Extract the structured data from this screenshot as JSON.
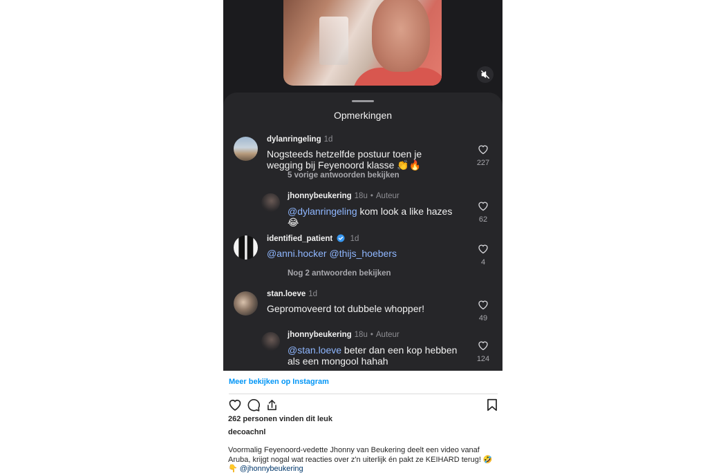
{
  "sheet": {
    "title": "Opmerkingen"
  },
  "comments": [
    {
      "username": "dylanringeling",
      "time": "1d",
      "text": "Nogsteeds hetzelfde postuur toen je wegging bij Feyenoord klasse 👏🔥",
      "likes": "227",
      "more_replies": "5 vorige antwoorden bekijken"
    },
    {
      "username": "jhonnybeukering",
      "time": "18u",
      "badge": "Auteur",
      "mention": "@dylanringeling",
      "text": " kom look a like hazes",
      "text2": "😂",
      "likes": "62"
    },
    {
      "username": "identified_patient",
      "time": "1d",
      "mention": "@anni.hocker @thijs_hoebers",
      "likes": "4",
      "more_replies": "Nog 2 antwoorden bekijken"
    },
    {
      "username": "stan.loeve",
      "time": "1d",
      "text": "Gepromoveerd tot dubbele whopper!",
      "likes": "49"
    },
    {
      "username": "jhonnybeukering",
      "time": "18u",
      "badge": "Auteur",
      "mention": "@stan.loeve",
      "text": " beter dan een kop hebben",
      "text2": "als een mongool hahah",
      "likes": "124"
    }
  ],
  "embed": {
    "view_more": "Meer bekijken op Instagram",
    "likes": "262 personen vinden dit leuk",
    "author": "decoachnl",
    "caption_line1": "Voormalig Feyenoord-vedette Jhonny van Beukering deelt een video vanaf",
    "caption_line2": "Aruba, krijgt nogal wat reacties over z'n uiterlijk én pakt ze KEIHARD terug! 🤣",
    "caption_pointer": "👇",
    "caption_mention": "@jhonnybeukering"
  },
  "icons": [
    "mute-icon",
    "heart-icon",
    "comment-icon",
    "share-icon",
    "bookmark-icon",
    "verified-icon"
  ],
  "colors": {
    "sheet_bg": "#262629",
    "mention": "#8fb7ff",
    "link_blue": "#0095f6"
  }
}
